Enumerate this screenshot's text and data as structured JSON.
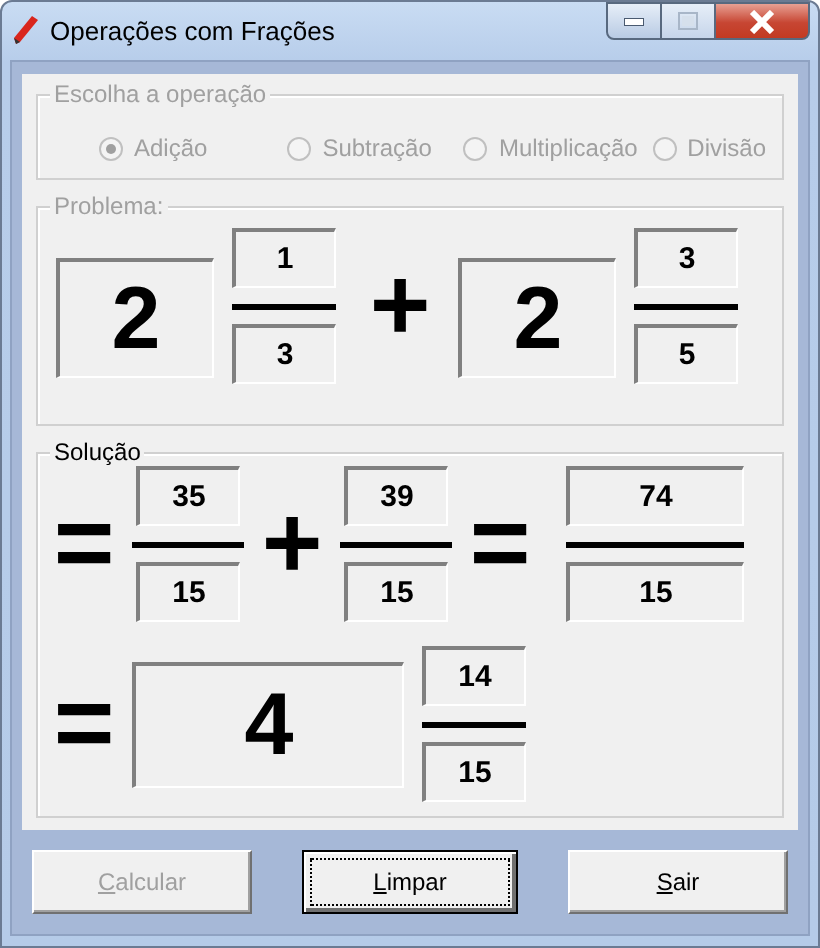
{
  "window": {
    "title": "Operações com Frações"
  },
  "operation": {
    "legend": "Escolha a operação",
    "disabled": true,
    "options": [
      {
        "label": "Adição",
        "selected": true
      },
      {
        "label": "Subtração",
        "selected": false
      },
      {
        "label": "Multiplicação",
        "selected": false
      },
      {
        "label": "Divisão",
        "selected": false
      }
    ]
  },
  "problem": {
    "legend": "Problema:",
    "disabled": true,
    "items": [
      {
        "kind": "mixed",
        "whole": "2",
        "numerator": "1",
        "denominator": "3"
      },
      {
        "kind": "operator",
        "symbol": "+"
      },
      {
        "kind": "mixed",
        "whole": "2",
        "numerator": "3",
        "denominator": "5"
      }
    ]
  },
  "solution": {
    "legend": "Solução",
    "disabled": false,
    "steps": [
      {
        "items": [
          {
            "kind": "operator",
            "symbol": "="
          },
          {
            "kind": "fraction",
            "numerator": "35",
            "denominator": "15"
          },
          {
            "kind": "operator",
            "symbol": "+"
          },
          {
            "kind": "fraction",
            "numerator": "39",
            "denominator": "15"
          },
          {
            "kind": "operator",
            "symbol": "="
          },
          {
            "kind": "wide-fraction",
            "numerator": "74",
            "denominator": "15"
          }
        ]
      },
      {
        "items": [
          {
            "kind": "operator",
            "symbol": "="
          },
          {
            "kind": "mixed",
            "whole": "4",
            "numerator": "14",
            "denominator": "15"
          }
        ]
      }
    ]
  },
  "buttons": [
    {
      "mnemonic": "C",
      "rest": "alcular",
      "disabled": true,
      "focused": false
    },
    {
      "mnemonic": "L",
      "rest": "impar",
      "disabled": false,
      "focused": true
    },
    {
      "mnemonic": "S",
      "rest": "air",
      "disabled": false,
      "focused": false
    }
  ]
}
